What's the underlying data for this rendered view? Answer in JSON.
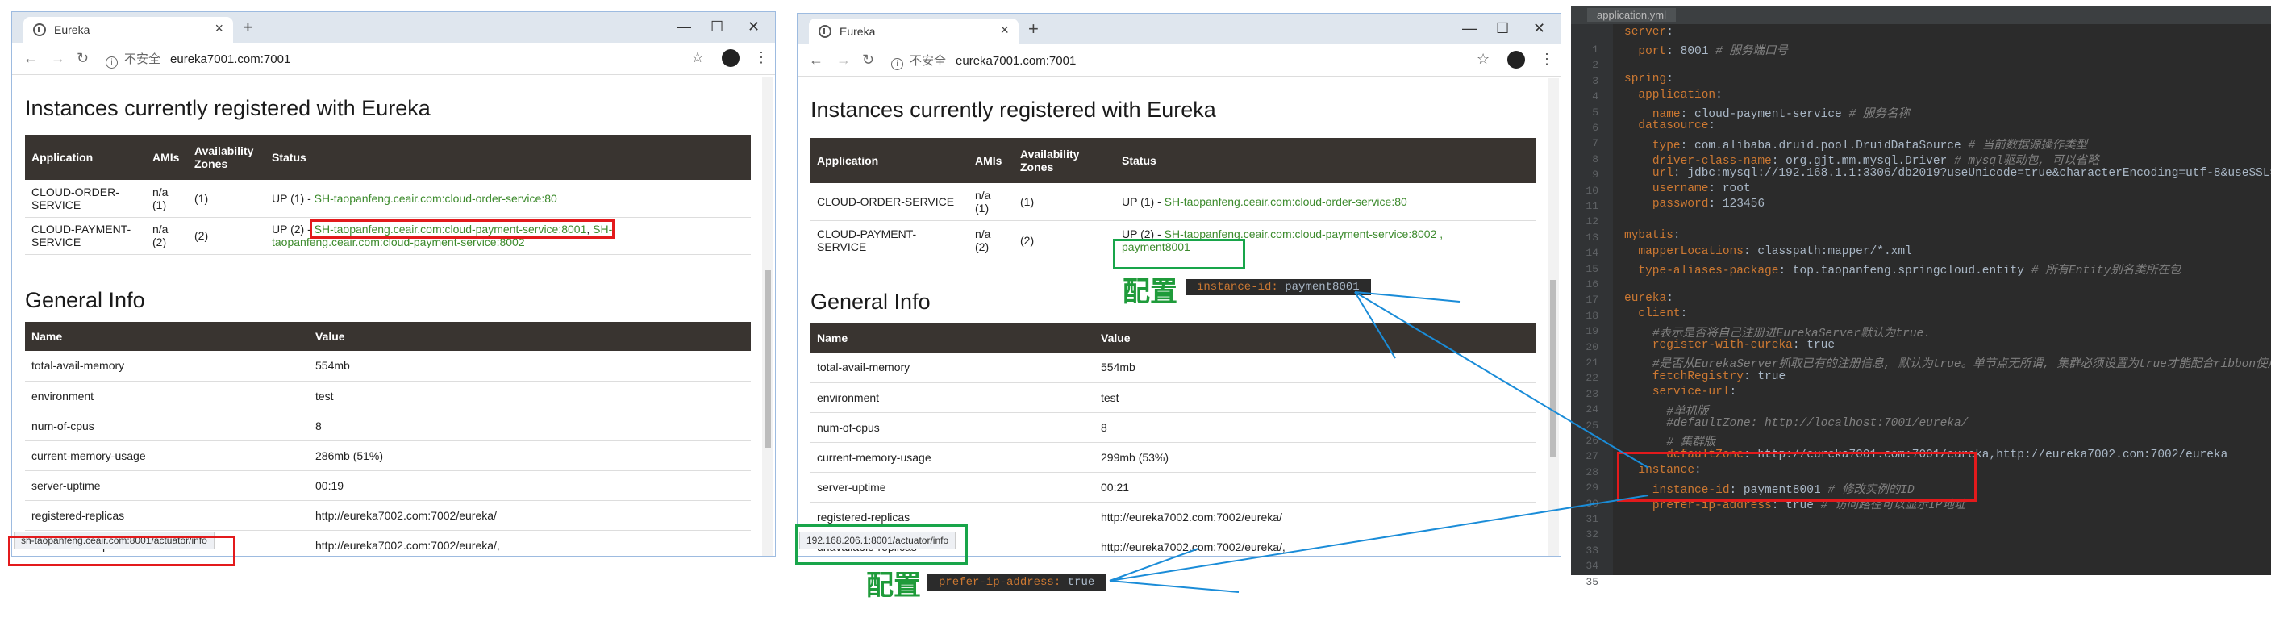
{
  "browser_left": {
    "tab_title": "Eureka",
    "url_insecure": "不安全",
    "url": "eureka7001.com:7001",
    "instances_heading": "Instances currently registered with Eureka",
    "instances_headers": [
      "Application",
      "AMIs",
      "Availability Zones",
      "Status"
    ],
    "instances": [
      {
        "app": "CLOUD-ORDER-SERVICE",
        "amis": "n/a (1)",
        "zones": "(1)",
        "status_prefix": "UP (1) -",
        "links": [
          "SH-taopanfeng.ceair.com:cloud-order-service:80"
        ]
      },
      {
        "app": "CLOUD-PAYMENT-SERVICE",
        "amis": "n/a (2)",
        "zones": "(2)",
        "status_prefix": "UP (2) -",
        "links": [
          "SH-taopanfeng.ceair.com:cloud-payment-service:8001",
          "SH-taopanfeng.ceair.com:cloud-payment-service:8002"
        ]
      }
    ],
    "general_heading": "General Info",
    "general_headers": [
      "Name",
      "Value"
    ],
    "general": [
      [
        "total-avail-memory",
        "554mb"
      ],
      [
        "environment",
        "test"
      ],
      [
        "num-of-cpus",
        "8"
      ],
      [
        "current-memory-usage",
        "286mb (51%)"
      ],
      [
        "server-uptime",
        "00:19"
      ],
      [
        "registered-replicas",
        "http://eureka7002.com:7002/eureka/"
      ],
      [
        "unavailable-replicas",
        "http://eureka7002.com:7002/eureka/,"
      ]
    ],
    "status_url": "sh-taopanfeng.ceair.com:8001/actuator/info"
  },
  "browser_right": {
    "tab_title": "Eureka",
    "url_insecure": "不安全",
    "url": "eureka7001.com:7001",
    "instances_heading": "Instances currently registered with Eureka",
    "instances_headers": [
      "Application",
      "AMIs",
      "Availability Zones",
      "Status"
    ],
    "instances": [
      {
        "app": "CLOUD-ORDER-SERVICE",
        "amis": "n/a (1)",
        "zones": "(1)",
        "status_prefix": "UP (1) -",
        "links": [
          "SH-taopanfeng.ceair.com:cloud-order-service:80"
        ]
      },
      {
        "app": "CLOUD-PAYMENT-SERVICE",
        "amis": "n/a (2)",
        "zones": "(2)",
        "status_prefix": "UP (2) -",
        "links": [
          "SH-taopanfeng.ceair.com:cloud-payment-service:8002 ,",
          "payment8001"
        ]
      }
    ],
    "general_heading": "General Info",
    "general_headers": [
      "Name",
      "Value"
    ],
    "general": [
      [
        "total-avail-memory",
        "554mb"
      ],
      [
        "environment",
        "test"
      ],
      [
        "num-of-cpus",
        "8"
      ],
      [
        "current-memory-usage",
        "299mb (53%)"
      ],
      [
        "server-uptime",
        "00:21"
      ],
      [
        "registered-replicas",
        "http://eureka7002.com:7002/eureka/"
      ],
      [
        "unavailable-replicas",
        "http://eureka7002.com:7002/eureka/,"
      ]
    ],
    "status_url": "192.168.206.1:8001/actuator/info"
  },
  "annotations": {
    "config_label": "配置",
    "instance_id_key": "instance-id",
    "instance_id_value": "payment8001",
    "prefer_ip_key": "prefer-ip-address",
    "prefer_ip_value": "true"
  },
  "ide": {
    "file_tab": "application.yml",
    "lines": [
      "server:",
      "  port: 8001 # 服务端口号",
      "",
      "spring:",
      "  application:",
      "    name: cloud-payment-service # 服务名称",
      "  datasource:",
      "    type: com.alibaba.druid.pool.DruidDataSource # 当前数据源操作类型",
      "    driver-class-name: org.gjt.mm.mysql.Driver # mysql驱动包, 可以省略",
      "    url: jdbc:mysql://192.168.1.1:3306/db2019?useUnicode=true&characterEncoding=utf-8&useSSL=false",
      "    username: root",
      "    password: 123456",
      "",
      "mybatis:",
      "  mapperLocations: classpath:mapper/*.xml",
      "  type-aliases-package: top.taopanfeng.springcloud.entity # 所有Entity别名类所在包",
      "",
      "eureka:",
      "  client:",
      "    #表示是否将自己注册进EurekaServer默认为true.",
      "    register-with-eureka: true",
      "    #是否从EurekaServer抓取已有的注册信息, 默认为true。单节点无所谓, 集群必须设置为true才能配合ribbon使用",
      "    fetchRegistry: true",
      "    service-url:",
      "      #单机版",
      "      #defaultZone: http://localhost:7001/eureka/",
      "      # 集群版",
      "      defaultZone: http://eureka7001.com:7001/eureka,http://eureka7002.com:7002/eureka",
      "  instance:",
      "    instance-id: payment8001 # 修改实例的ID",
      "    prefer-ip-address: true # 访问路径可以显示IP地址",
      "",
      "",
      "",
      ""
    ]
  },
  "colors": {
    "table_header": "#393430",
    "link_green": "#3c8a2c",
    "red_box": "#e31a1c",
    "green_box": "#18a54a",
    "arrow_blue": "#1a8cd8"
  }
}
